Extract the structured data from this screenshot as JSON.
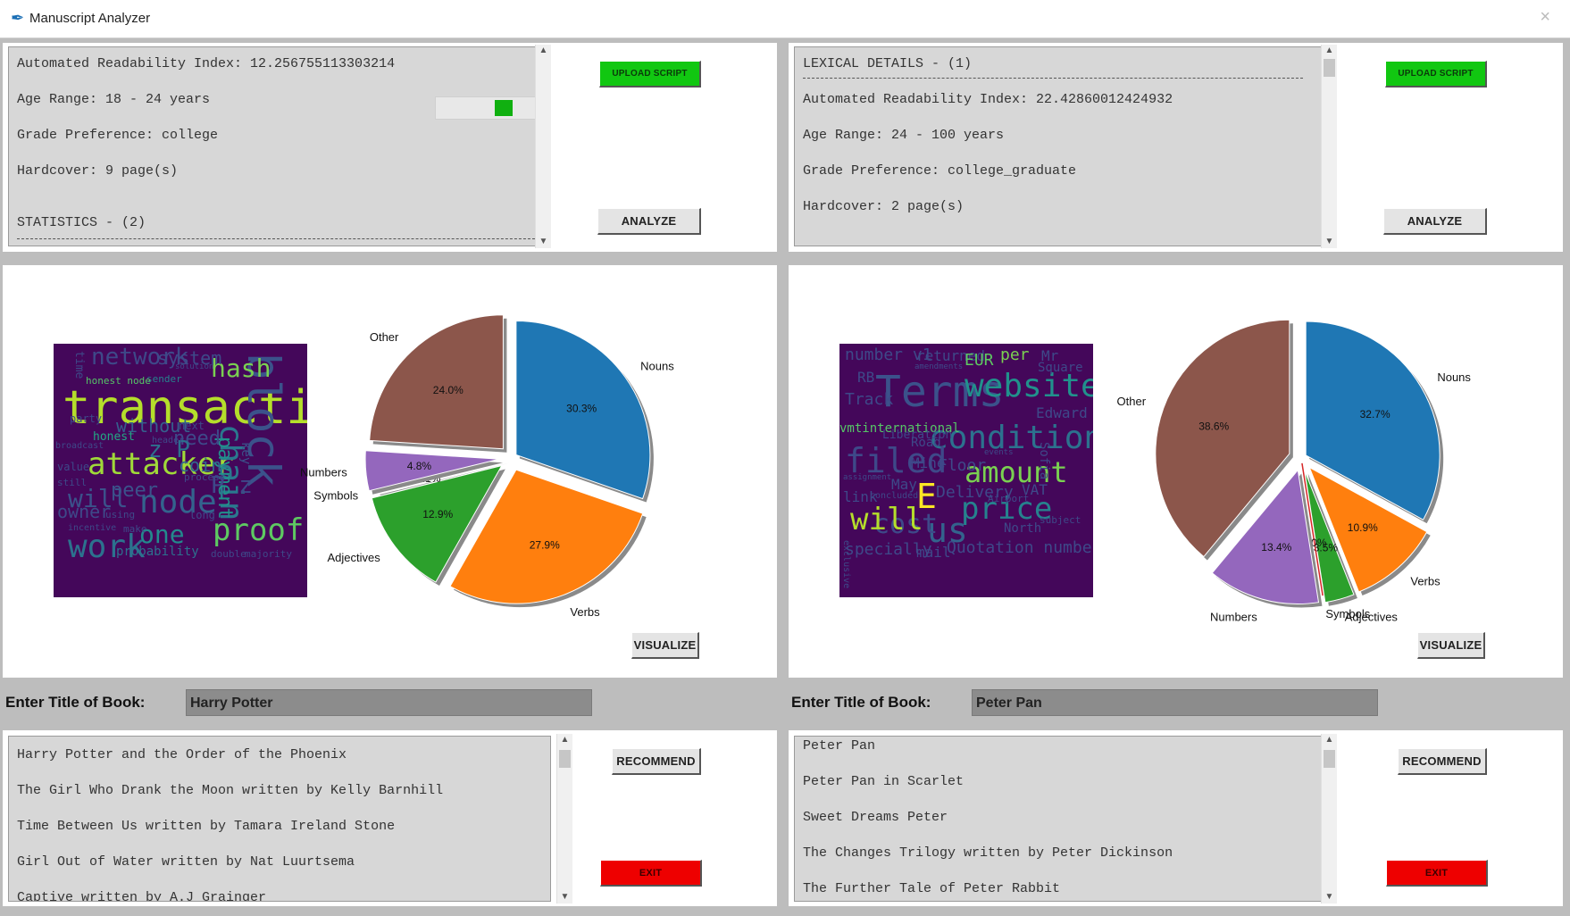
{
  "window": {
    "title": "Manuscript Analyzer",
    "close_glyph": "×"
  },
  "left": {
    "details_lines": [
      "Automated Readability Index: 12.256755113303214",
      "Age Range: 18 - 24 years",
      "Grade Preference: college",
      "Hardcover: 9 page(s)",
      "",
      "STATISTICS - (2)"
    ],
    "progress": 0.55,
    "upload_label": "UPLOAD SCRIPT",
    "analyze_label": "ANALYZE",
    "visualize_label": "VISUALIZE",
    "recommend_label": "RECOMMEND",
    "exit_label": "EXIT",
    "title_prompt": "Enter Title of Book:",
    "title_value": "Harry Potter",
    "recommendations": [
      "Harry Potter and the Order of the Phoenix",
      "The Girl Who Drank the Moon written by Kelly Barnhill",
      "Time Between Us written by Tamara Ireland Stone",
      "Girl Out of Water written by Nat Luurtsema",
      "Captive written by A.J Grainger"
    ],
    "wordcloud_words": [
      {
        "t": "transaction",
        "c": "#b5de2b",
        "s": 52
      },
      {
        "t": "block",
        "c": "#3b528b",
        "s": 50
      },
      {
        "t": "attacker",
        "c": "#a0da39",
        "s": 34
      },
      {
        "t": "chain",
        "c": "#2a788e",
        "s": 36
      },
      {
        "t": "proof",
        "c": "#5ec962",
        "s": 34
      },
      {
        "t": "node",
        "c": "#33638d",
        "s": 36
      },
      {
        "t": "work",
        "c": "#2c728e",
        "s": 36
      },
      {
        "t": "hash",
        "c": "#7ad151",
        "s": 28
      },
      {
        "t": "network",
        "c": "#3e4989",
        "s": 26
      },
      {
        "t": "system",
        "c": "#3e4a89",
        "s": 20
      },
      {
        "t": "payment",
        "c": "#21918c",
        "s": 22
      },
      {
        "t": "one",
        "c": "#238a8d",
        "s": 28
      },
      {
        "t": "coin",
        "c": "#31688e",
        "s": 20
      },
      {
        "t": "need",
        "c": "#3e4989",
        "s": 22
      },
      {
        "t": "will",
        "c": "#3b528b",
        "s": 28
      },
      {
        "t": "peer",
        "c": "#3b528b",
        "s": 22
      },
      {
        "t": "owner",
        "c": "#3e4989",
        "s": 20
      },
      {
        "t": "probability",
        "c": "#2d708e",
        "s": 14
      },
      {
        "t": "without",
        "c": "#355f8d",
        "s": 20
      },
      {
        "t": "sender",
        "c": "#26828e",
        "s": 11
      },
      {
        "t": "honest node",
        "c": "#56c667",
        "s": 11
      },
      {
        "t": "party",
        "c": "#3e4989",
        "s": 12
      },
      {
        "t": "z P",
        "c": "#2d708e",
        "s": 26
      },
      {
        "t": "P z",
        "c": "#3e4989",
        "s": 26
      },
      {
        "t": "honest",
        "c": "#22a884",
        "s": 13
      },
      {
        "t": "key",
        "c": "#3b528b",
        "s": 14
      },
      {
        "t": "time",
        "c": "#3e4989",
        "s": 13
      },
      {
        "t": "value",
        "c": "#3e4989",
        "s": 12
      },
      {
        "t": "broadcast",
        "c": "#3e4989",
        "s": 10
      },
      {
        "t": "still",
        "c": "#3e4989",
        "s": 11
      },
      {
        "t": "incentive",
        "c": "#3e4989",
        "s": 10
      },
      {
        "t": "using",
        "c": "#3e4989",
        "s": 11
      },
      {
        "t": "make",
        "c": "#3e4989",
        "s": 11
      },
      {
        "t": "long",
        "c": "#3e4989",
        "s": 12
      },
      {
        "t": "next",
        "c": "#3e4989",
        "s": 12
      },
      {
        "t": "double",
        "c": "#3e4989",
        "s": 11
      },
      {
        "t": "majority",
        "c": "#3e4989",
        "s": 11
      },
      {
        "t": "solution",
        "c": "#3e4989",
        "s": 9
      },
      {
        "t": "header",
        "c": "#3e4989",
        "s": 10
      },
      {
        "t": "process",
        "c": "#3e4989",
        "s": 11
      }
    ],
    "chart_data": {
      "type": "pie",
      "slices": [
        {
          "label": "Nouns",
          "value": 30.3,
          "pct": "30.3%",
          "color": "#1f77b4"
        },
        {
          "label": "Verbs",
          "value": 27.9,
          "pct": "27.9%",
          "color": "#ff7f0e"
        },
        {
          "label": "Adjectives",
          "value": 12.9,
          "pct": "12.9%",
          "color": "#2ca02c"
        },
        {
          "label": "Symbols",
          "value": 0.1,
          "pct": "0.1%",
          "color": "#d62728"
        },
        {
          "label": "Numbers",
          "value": 4.8,
          "pct": "4.8%",
          "color": "#9467bd"
        },
        {
          "label": "Other",
          "value": 24.0,
          "pct": "24.0%",
          "color": "#8c564b"
        }
      ]
    }
  },
  "right": {
    "details_lines": [
      "LEXICAL DETAILS - (1)",
      "",
      "Automated Readability Index: 22.42860012424932",
      "Age Range: 24 - 100 years",
      "Grade Preference: college_graduate",
      "Hardcover: 2 page(s)"
    ],
    "upload_label": "UPLOAD SCRIPT",
    "analyze_label": "ANALYZE",
    "visualize_label": "VISUALIZE",
    "recommend_label": "RECOMMEND",
    "exit_label": "EXIT",
    "title_prompt": "Enter Title of Book:",
    "title_value": "Peter Pan",
    "recommendations": [
      "Peter Pan",
      "Peter Pan in Scarlet",
      "Sweet Dreams Peter",
      "The Changes Trilogy written by Peter Dickinson",
      "The Further Tale of Peter Rabbit"
    ],
    "wordcloud_words": [
      {
        "t": "Terms",
        "c": "#3b528b",
        "s": 48
      },
      {
        "t": "website",
        "c": "#21918c",
        "s": 36
      },
      {
        "t": "conditions",
        "c": "#2c728e",
        "s": 36
      },
      {
        "t": "filed",
        "c": "#3e4989",
        "s": 38
      },
      {
        "t": "amount",
        "c": "#7ad151",
        "s": 32
      },
      {
        "t": "price",
        "c": "#26828e",
        "s": 34
      },
      {
        "t": "us",
        "c": "#33638d",
        "s": 38
      },
      {
        "t": "cost",
        "c": "#3e4989",
        "s": 30
      },
      {
        "t": "will",
        "c": "#b5de2b",
        "s": 34
      },
      {
        "t": "E",
        "c": "#fde725",
        "s": 38
      },
      {
        "t": "number v1",
        "c": "#3e4989",
        "s": 18
      },
      {
        "t": "returned",
        "c": "#3e4989",
        "s": 16
      },
      {
        "t": "EUR",
        "c": "#5ec962",
        "s": 18
      },
      {
        "t": "per",
        "c": "#7ad151",
        "s": 18
      },
      {
        "t": "Mr",
        "c": "#3e4989",
        "s": 16
      },
      {
        "t": "Square",
        "c": "#3e4989",
        "s": 14
      },
      {
        "t": "RB",
        "c": "#3e4989",
        "s": 16
      },
      {
        "t": "Track",
        "c": "#3e4989",
        "s": 18
      },
      {
        "t": "Edward",
        "c": "#3e4989",
        "s": 16
      },
      {
        "t": "vmtinternational",
        "c": "#56c667",
        "s": 14
      },
      {
        "t": "Liberation",
        "c": "#3e4989",
        "s": 13
      },
      {
        "t": "Road",
        "c": "#3e4989",
        "s": 14
      },
      {
        "t": "Mine",
        "c": "#3e4989",
        "s": 16
      },
      {
        "t": "Floor",
        "c": "#3e4989",
        "s": 18
      },
      {
        "t": "May",
        "c": "#3e4989",
        "s": 16
      },
      {
        "t": "Delivery",
        "c": "#3e4989",
        "s": 18
      },
      {
        "t": "VAT",
        "c": "#3e4989",
        "s": 16
      },
      {
        "t": "link",
        "c": "#3e4989",
        "s": 16
      },
      {
        "t": "specially",
        "c": "#3e4989",
        "s": 18
      },
      {
        "t": "mail",
        "c": "#3e4989",
        "s": 16
      },
      {
        "t": "Quotation number",
        "c": "#3e4989",
        "s": 18
      },
      {
        "t": "North",
        "c": "#3e4989",
        "s": 14
      },
      {
        "t": "subject",
        "c": "#3e4989",
        "s": 11
      },
      {
        "t": "exclusive",
        "c": "#3e4989",
        "s": 10
      },
      {
        "t": "concluded",
        "c": "#3e4989",
        "s": 10
      },
      {
        "t": "assignment",
        "c": "#3e4989",
        "s": 9
      },
      {
        "t": "Airport",
        "c": "#3e4989",
        "s": 11
      },
      {
        "t": "Sofia",
        "c": "#3e4989",
        "s": 14
      },
      {
        "t": "amendments",
        "c": "#3e4989",
        "s": 9
      },
      {
        "t": "events",
        "c": "#3e4989",
        "s": 9
      }
    ],
    "chart_data": {
      "type": "pie",
      "slices": [
        {
          "label": "Nouns",
          "value": 32.7,
          "pct": "32.7%",
          "color": "#1f77b4"
        },
        {
          "label": "Verbs",
          "value": 10.9,
          "pct": "10.9%",
          "color": "#ff7f0e"
        },
        {
          "label": "Adjectives",
          "value": 3.5,
          "pct": "3.5%",
          "color": "#2ca02c"
        },
        {
          "label": "Symbols",
          "value": 0.0,
          "pct": "0.0%",
          "color": "#d62728"
        },
        {
          "label": "Numbers",
          "value": 13.4,
          "pct": "13.4%",
          "color": "#9467bd"
        },
        {
          "label": "Other",
          "value": 38.6,
          "pct": "38.6%",
          "color": "#8c564b"
        }
      ]
    }
  }
}
